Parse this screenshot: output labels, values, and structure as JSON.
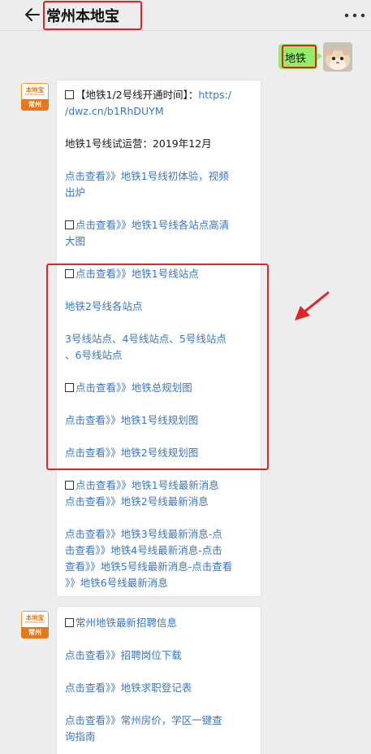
{
  "header": {
    "title": "常州本地宝"
  },
  "user_message": {
    "text": "地铁"
  },
  "bot": {
    "avatar_brand": "本地宝",
    "avatar_url": "bendibao.com",
    "avatar_city": "常州"
  },
  "message1": {
    "line1": "【地铁1/2号线开通时间】：",
    "line1_link": "https:/",
    "line2": "/dwz.cn/b1RhDUYM",
    "line3": "地铁1号线试运营：2019年12月",
    "line4": "点击查看》》地铁1号线初体验，视频",
    "line5": "出炉",
    "line6": "点击查看》》地铁1号线各站点高清",
    "line7": "大图",
    "line8": "点击查看》》地铁1号线站点",
    "line9": "地铁2号线各站点",
    "line10": "3号线站点、4号线站点、5号线站点",
    "line11": "、6号线站点",
    "line12": "点击查看》》地铁总规划图",
    "line13": "点击查看》》地铁1号线规划图",
    "line14": "点击查看》》地铁2号线规划图",
    "line15": "点击查看》》地铁1号线最新消息",
    "line16": "点击查看》》地铁2号线最新消息",
    "line17": "点击查看》》地铁3号线最新消息-点",
    "line18": "击查看》》地铁4号线最新消息-点击",
    "line19": "查看》》地铁5号线最新消息-点击查看",
    "line20": "》》地铁6号线最新消息"
  },
  "message2": {
    "line1": "常州地铁最新招聘信息",
    "line2": "点击查看》》招聘岗位下载",
    "line3": "点击查看》》地铁求职登记表",
    "line4": "点击查看》》常州房价，学区一键查",
    "line5": "询指南"
  },
  "colors": {
    "link_blue": "#3a76c0",
    "highlight_red": "#e0252a",
    "user_bubble_green": "#95ec69",
    "brand_orange": "#e5781a"
  }
}
